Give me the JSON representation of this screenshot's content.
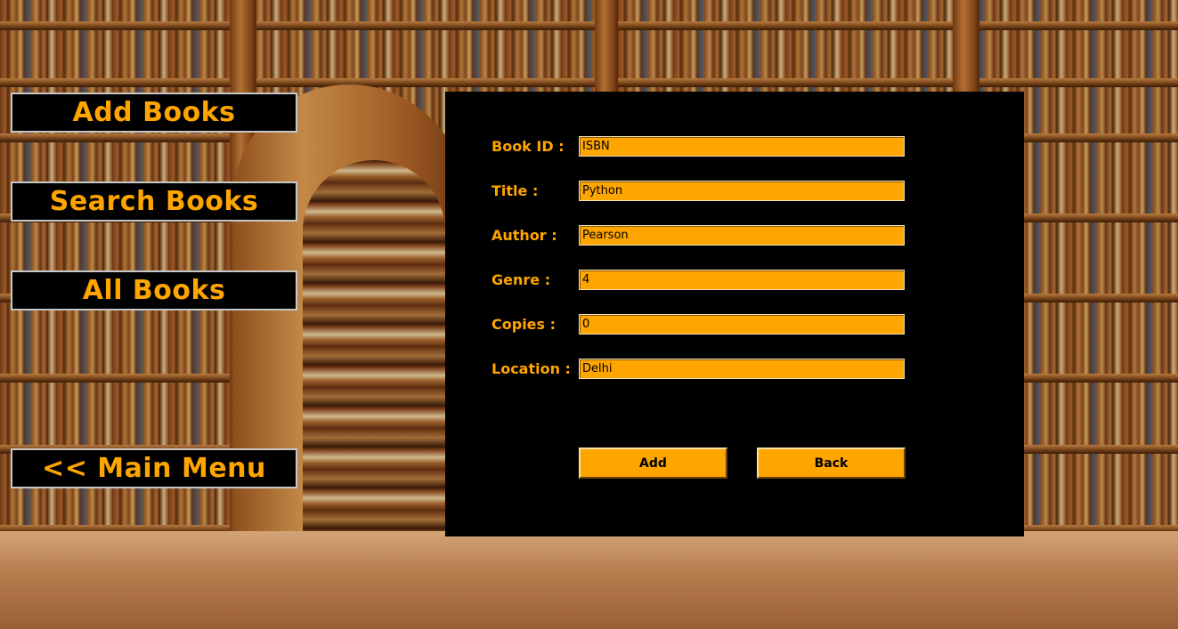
{
  "menu": {
    "add_books": "Add Books",
    "search_books": "Search Books",
    "all_books": "All Books",
    "main_menu": "<< Main Menu"
  },
  "form": {
    "book_id": {
      "label": "Book ID :",
      "value": "ISBN"
    },
    "title": {
      "label": "Title :",
      "value": "Python"
    },
    "author": {
      "label": "Author :",
      "value": "Pearson"
    },
    "genre": {
      "label": "Genre :",
      "value": "4"
    },
    "copies": {
      "label": "Copies :",
      "value": "0"
    },
    "location": {
      "label": "Location :",
      "value": "Delhi"
    }
  },
  "buttons": {
    "add": "Add",
    "back": "Back"
  },
  "colors": {
    "accent": "#FFA500",
    "panel": "#000000"
  }
}
